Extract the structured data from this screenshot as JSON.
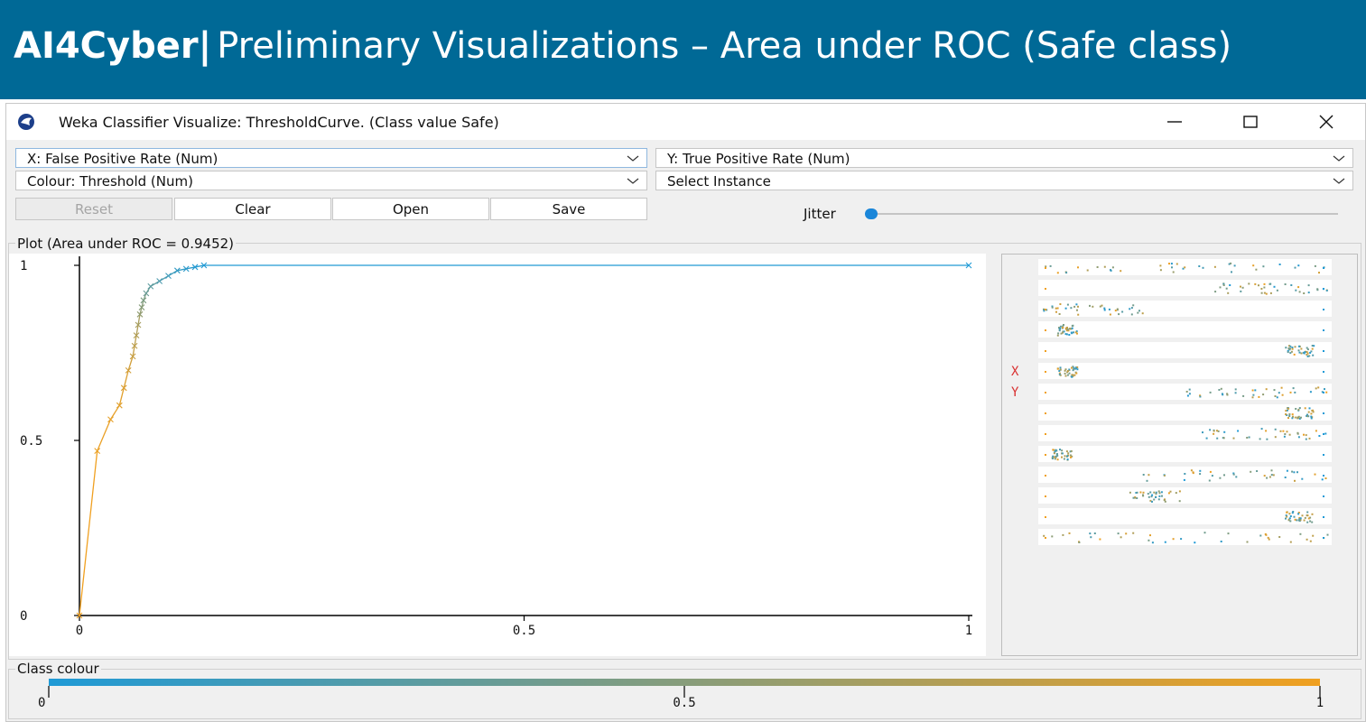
{
  "banner": {
    "title_bold": "AI4Cyber",
    "separator": "|",
    "title_rest": "Preliminary Visualizations – Area under ROC (Safe class)"
  },
  "window": {
    "title": "Weka Classifier Visualize: ThresholdCurve. (Class value Safe)",
    "icon": "weka-bird-icon",
    "controls": [
      "minimize-icon",
      "maximize-icon",
      "close-icon"
    ]
  },
  "selectors": {
    "x_axis": "X: False Positive Rate (Num)",
    "y_axis": "Y: True Positive Rate (Num)",
    "colour": "Colour: Threshold (Num)",
    "instance": "Select Instance"
  },
  "buttons": {
    "reset": "Reset",
    "clear": "Clear",
    "open": "Open",
    "save": "Save"
  },
  "jitter": {
    "label": "Jitter",
    "value": 0
  },
  "plot": {
    "group_title": "Plot (Area under ROC = 0.9452)"
  },
  "matrix": {
    "x_marker": "X",
    "y_marker": "Y",
    "rows": 14
  },
  "class_colour": {
    "title": "Class colour",
    "ticks": [
      "0",
      "0.5",
      "1"
    ],
    "low_color": "#1f9ad6",
    "high_color": "#f0a020"
  },
  "colors": {
    "banner": "#006996",
    "series_line": "#2a9fd6",
    "low": "#f0a020",
    "high": "#1f9ad6"
  },
  "chart_data": {
    "type": "line",
    "title": "Plot (Area under ROC = 0.9452)",
    "xlabel": "",
    "ylabel": "",
    "xlim": [
      0,
      1
    ],
    "ylim": [
      0,
      1
    ],
    "x_ticks": [
      "0",
      "0.5",
      "1"
    ],
    "y_ticks": [
      "0",
      "0.5",
      "1"
    ],
    "colour_by": "Threshold",
    "series": [
      {
        "x": [
          0.0,
          0.02,
          0.035,
          0.045,
          0.05,
          0.055,
          0.06,
          0.062,
          0.064,
          0.066,
          0.068,
          0.07,
          0.072,
          0.075,
          0.08,
          0.09,
          0.1,
          0.11,
          0.12,
          0.13,
          0.14,
          1.0
        ],
        "y": [
          0.0,
          0.47,
          0.56,
          0.6,
          0.65,
          0.7,
          0.74,
          0.77,
          0.8,
          0.83,
          0.86,
          0.88,
          0.9,
          0.92,
          0.94,
          0.955,
          0.97,
          0.985,
          0.99,
          0.995,
          1.0,
          1.0
        ],
        "threshold": [
          1.0,
          0.97,
          0.95,
          0.93,
          0.9,
          0.85,
          0.8,
          0.75,
          0.7,
          0.65,
          0.55,
          0.5,
          0.45,
          0.35,
          0.3,
          0.22,
          0.15,
          0.1,
          0.06,
          0.03,
          0.01,
          0.0
        ]
      }
    ]
  }
}
